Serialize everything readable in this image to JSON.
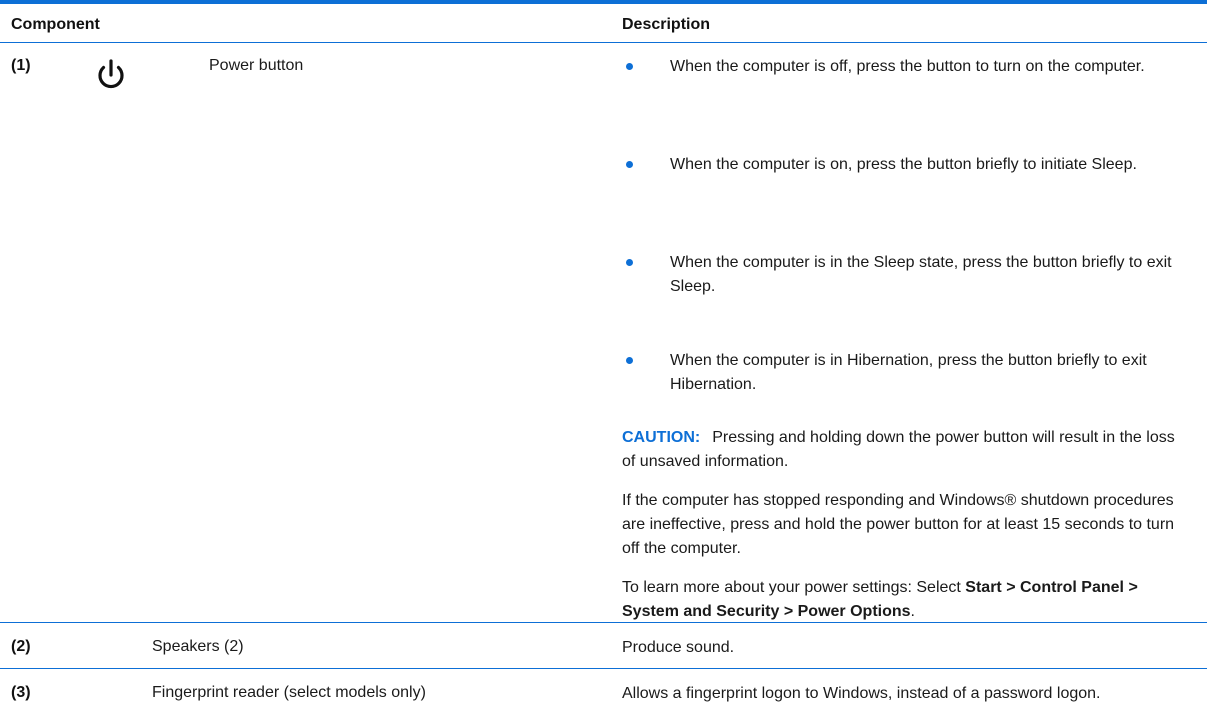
{
  "table": {
    "headers": {
      "component": "Component",
      "description": "Description"
    },
    "rows": [
      {
        "num": "(1)",
        "icon": "power-icon",
        "name": "Power button",
        "bullets": [
          "When the computer is off, press the button to turn on the computer.",
          "When the computer is on, press the button briefly to initiate Sleep.",
          "When the computer is in the Sleep state, press the button briefly to exit Sleep.",
          "When the computer is in Hibernation, press the button briefly to exit Hibernation."
        ],
        "caution_label": "CAUTION:",
        "caution_text": "Pressing and holding down the power button will result in the loss of unsaved information.",
        "paragraph": "If the computer has stopped responding and Windows® shutdown procedures are ineffective, press and hold the power button for at least 15 seconds to turn off the computer.",
        "settings_prefix": "To learn more about your power settings: Select ",
        "settings_path": "Start > Control Panel > System and Security > Power Options",
        "settings_suffix": "."
      },
      {
        "num": "(2)",
        "name": "Speakers (2)",
        "description": "Produce sound."
      },
      {
        "num": "(3)",
        "name": "Fingerprint reader (select models only)",
        "description": "Allows a fingerprint logon to Windows, instead of a password logon."
      }
    ]
  },
  "colors": {
    "accent": "#0d6fd6",
    "text": "#1a1a1a"
  }
}
